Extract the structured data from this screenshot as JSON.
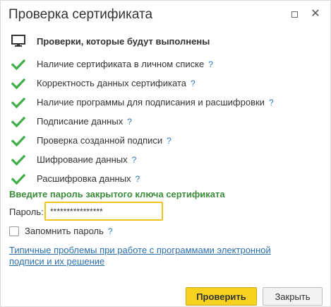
{
  "dialog": {
    "title": "Проверка сертификата",
    "maximize_icon": "maximize-icon",
    "close_icon": "close-icon"
  },
  "checks": {
    "header": "Проверки, которые будут выполнены",
    "help_symbol": "?",
    "items": [
      {
        "label": "Наличие сертификата в личном списке",
        "status": "passed"
      },
      {
        "label": "Корректность данных сертификата",
        "status": "passed"
      },
      {
        "label": "Наличие программы для подписания и расшифровки",
        "status": "passed"
      },
      {
        "label": "Подписание данных",
        "status": "passed"
      },
      {
        "label": "Проверка созданной подписи",
        "status": "passed"
      },
      {
        "label": "Шифрование данных",
        "status": "passed"
      },
      {
        "label": "Расшифровка данных",
        "status": "passed"
      }
    ]
  },
  "password": {
    "heading": "Введите пароль закрытого ключа сертификата",
    "label": "Пароль:",
    "value": "****************",
    "remember_label": "Запомнить пароль",
    "remember_checked": false
  },
  "links": {
    "problems": "Типичные проблемы при работе с программами электронной подписи и их решение"
  },
  "buttons": {
    "verify": "Проверить",
    "close": "Закрыть"
  },
  "colors": {
    "check_green": "#3fae49",
    "heading_green": "#3a8b3a",
    "help_blue": "#2a7ac0",
    "primary_yellow": "#f6d21f",
    "input_focus_border": "#f0c419"
  }
}
